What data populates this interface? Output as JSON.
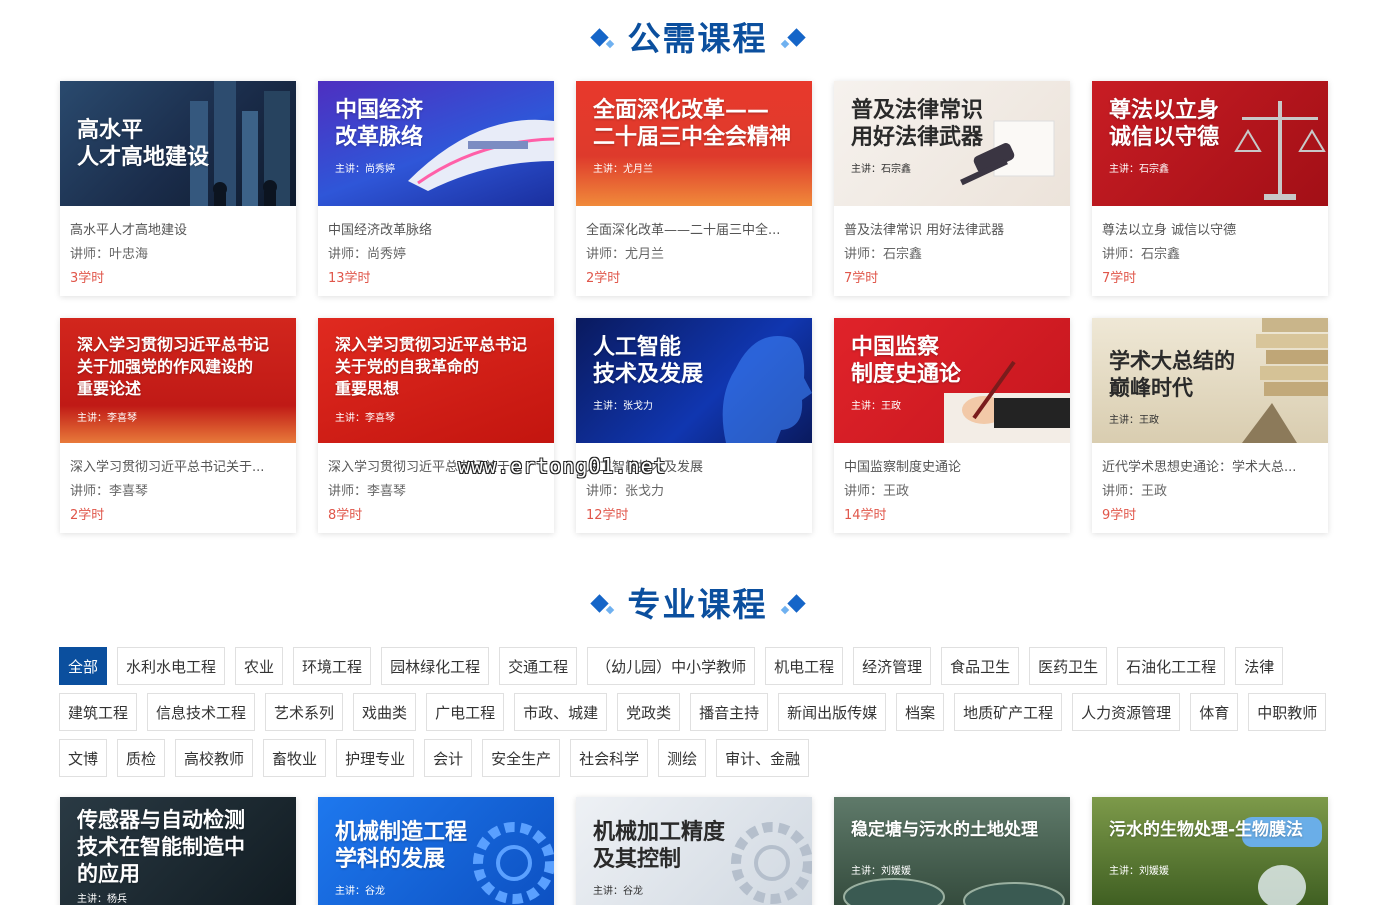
{
  "public_section": {
    "title": "公需课程"
  },
  "professional_section": {
    "title": "专业课程"
  },
  "public_courses": [
    {
      "thumb_title": "高水平\n人才高地建设",
      "thumb_lecturer": "",
      "name": "高水平人才高地建设",
      "teacher": "讲师：叶忠海",
      "hours": "3学时",
      "bg": "#1a2c4a"
    },
    {
      "thumb_title": "中国经济\n改革脉络",
      "thumb_lecturer": "主讲：尚秀婷",
      "name": "中国经济改革脉络",
      "teacher": "讲师：尚秀婷",
      "hours": "13学时",
      "bg": "#3a3bc8"
    },
    {
      "thumb_title": "全面深化改革——\n二十届三中全会精神",
      "thumb_lecturer": "主讲：尤月兰",
      "name": "全面深化改革——二十届三中全...",
      "teacher": "讲师：尤月兰",
      "hours": "2学时",
      "bg": "#e23a2e"
    },
    {
      "thumb_title": "普及法律常识\n用好法律武器",
      "thumb_lecturer": "主讲：石宗鑫",
      "name": "普及法律常识 用好法律武器",
      "teacher": "讲师：石宗鑫",
      "hours": "7学时",
      "bg": "#efe8e2"
    },
    {
      "thumb_title": "尊法以立身\n诚信以守德",
      "thumb_lecturer": "主讲：石宗鑫",
      "name": "尊法以立身 诚信以守德",
      "teacher": "讲师：石宗鑫",
      "hours": "7学时",
      "bg": "#b8141c"
    },
    {
      "thumb_title": "深入学习贯彻习近平总书记\n关于加强党的作风建设的\n重要论述",
      "thumb_lecturer": "主讲：李喜琴",
      "name": "深入学习贯彻习近平总书记关于...",
      "teacher": "讲师：李喜琴",
      "hours": "2学时",
      "bg": "#d2261d"
    },
    {
      "thumb_title": "深入学习贯彻习近平总书记\n关于党的自我革命的\n重要思想",
      "thumb_lecturer": "主讲：李喜琴",
      "name": "深入学习贯彻习近平总书记关于...",
      "teacher": "讲师：李喜琴",
      "hours": "8学时",
      "bg": "#d52019"
    },
    {
      "thumb_title": "人工智能\n技术及发展",
      "thumb_lecturer": "主讲：张戈力",
      "name": "人工智能技术及发展",
      "teacher": "讲师：张戈力",
      "hours": "12学时",
      "bg": "#0c1f6e"
    },
    {
      "thumb_title": "中国监察\n制度史通论",
      "thumb_lecturer": "主讲：王政",
      "name": "中国监察制度史通论",
      "teacher": "讲师：王政",
      "hours": "14学时",
      "bg": "#d81e26"
    },
    {
      "thumb_title": "学术大总结的\n巅峰时代",
      "thumb_lecturer": "主讲：王政",
      "name": "近代学术思想史通论：学术大总...",
      "teacher": "讲师：王政",
      "hours": "9学时",
      "bg": "#e6dcc4"
    }
  ],
  "tags": [
    "全部",
    "水利水电工程",
    "农业",
    "环境工程",
    "园林绿化工程",
    "交通工程",
    "（幼儿园）中小学教师",
    "机电工程",
    "经济管理",
    "食品卫生",
    "医药卫生",
    "石油化工工程",
    "法律",
    "建筑工程",
    "信息技术工程",
    "艺术系列",
    "戏曲类",
    "广电工程",
    "市政、城建",
    "党政类",
    "播音主持",
    "新闻出版传媒",
    "档案",
    "地质矿产工程",
    "人力资源管理",
    "体育",
    "中职教师",
    "文博",
    "质检",
    "高校教师",
    "畜牧业",
    "护理专业",
    "会计",
    "安全生产",
    "社会科学",
    "测绘",
    "审计、金融"
  ],
  "active_tag": "全部",
  "professional_courses": [
    {
      "thumb_title": "传感器与自动检测\n技术在智能制造中\n的应用",
      "thumb_lecturer": "主讲：杨兵",
      "bg": "#1d2a33"
    },
    {
      "thumb_title": "机械制造工程\n学科的发展",
      "thumb_lecturer": "主讲：谷龙",
      "bg": "#1766d6"
    },
    {
      "thumb_title": "机械加工精度\n及其控制",
      "thumb_lecturer": "主讲：谷龙",
      "bg": "#dde3ea"
    },
    {
      "thumb_title": "稳定塘与污水的土地处理",
      "thumb_lecturer": "主讲：刘媛媛",
      "bg": "#3f5a4a"
    },
    {
      "thumb_title": "污水的生物处理-生物膜法",
      "thumb_lecturer": "主讲：刘媛媛",
      "bg": "#4b6e2a"
    }
  ],
  "watermark": "www.ertong01.net"
}
